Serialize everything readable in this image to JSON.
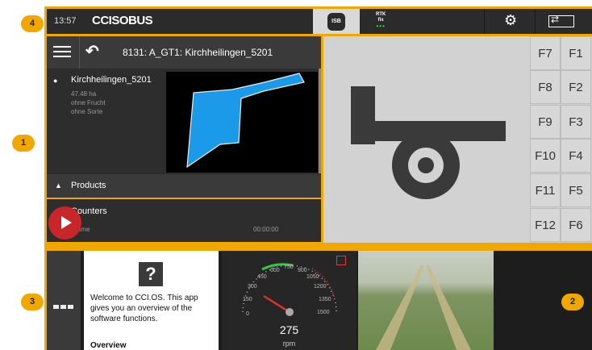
{
  "top_bar": {
    "time": "13:57",
    "logo": "CCISOBUS",
    "isb_label": "ISB",
    "rtk_label": "RTK",
    "rtk_sub": "fix",
    "settings_icon": "gear-icon",
    "switch_icon": "screen-switch-icon"
  },
  "app_header": {
    "title": "8131: A_GT1: Kirchheilingen_5201",
    "menu_icon": "hamburger-icon",
    "back_icon": "back-arrow-icon"
  },
  "field": {
    "name": "Kirchheilingen_5201",
    "area": "47.48 ha",
    "crop": "ohne Frucht",
    "variety": "ohne Sorte"
  },
  "list": {
    "products_label": "Products",
    "counters_label": "Counters",
    "counter_sub_label": "al time",
    "counter_value": "00:00:00"
  },
  "function_keys": [
    [
      "F7",
      "F1"
    ],
    [
      "F8",
      "F2"
    ],
    [
      "F9",
      "F3"
    ],
    [
      "F10",
      "F4"
    ],
    [
      "F11",
      "F5"
    ],
    [
      "F12",
      "F6"
    ]
  ],
  "help": {
    "icon_text": "?",
    "text": "Welcome to CCI.OS. This app gives you an overview of the software functions.",
    "heading": "Overview"
  },
  "tachometer": {
    "value": "275",
    "unit": "rpm",
    "scale": [
      "0",
      "150",
      "300",
      "450",
      "600",
      "750",
      "900",
      "1050",
      "1200",
      "1350",
      "1500"
    ]
  },
  "callouts": [
    "1",
    "2",
    "3",
    "4"
  ],
  "colors": {
    "accent": "#f0a800",
    "play": "#c8262a",
    "field_shape": "#1a9ae8",
    "needle": "#e03030"
  }
}
